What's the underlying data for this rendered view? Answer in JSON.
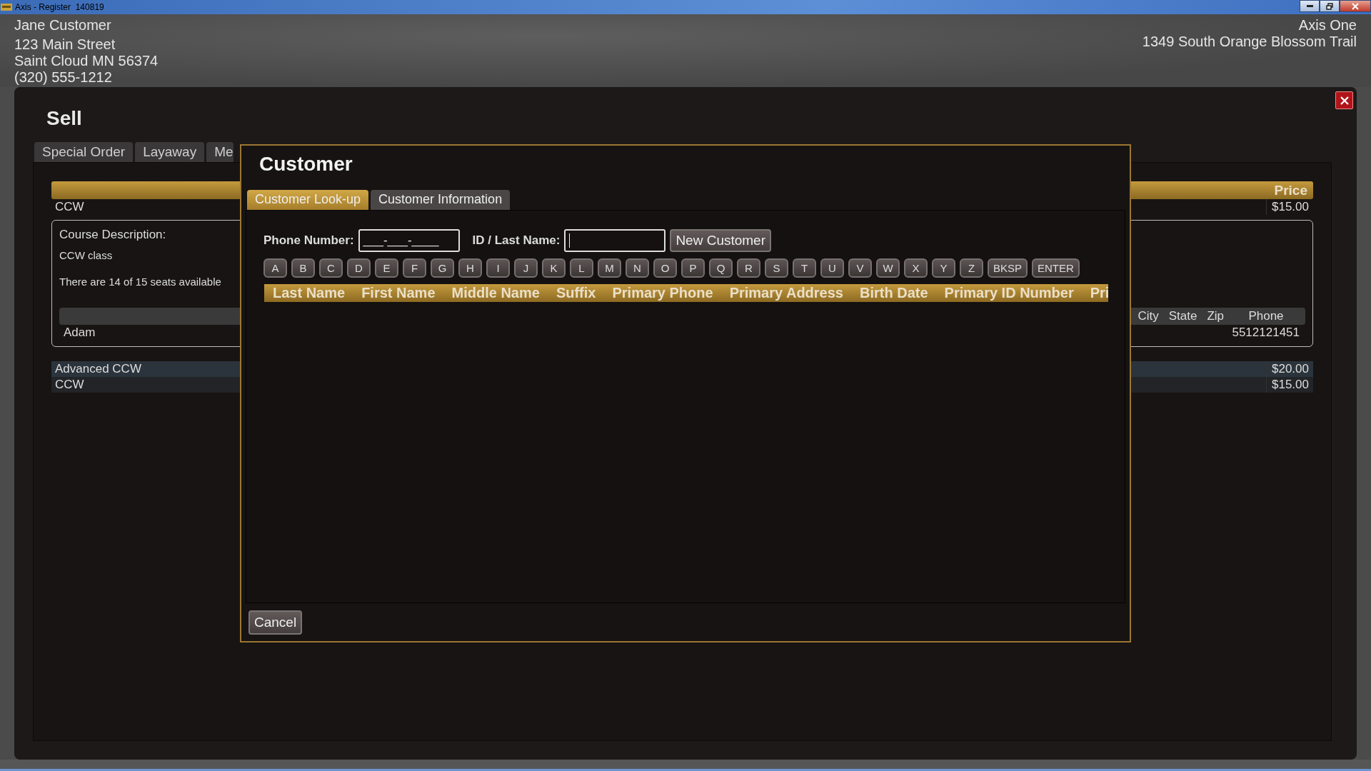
{
  "window": {
    "title": "Axis - Register  140819"
  },
  "customer": {
    "name": "Jane Customer",
    "address_lines": [
      "123 Main Street",
      "Saint Cloud MN 56374",
      "(320) 555-1212"
    ]
  },
  "store": {
    "name": "Axis One",
    "address": "1349 South Orange Blossom Trail"
  },
  "sell": {
    "title": "Sell",
    "sub_tabs": [
      {
        "label": "Special Order",
        "selected": false
      },
      {
        "label": "Layaway",
        "selected": false
      },
      {
        "label": "Me",
        "selected": false
      }
    ],
    "classes_table": {
      "price_header": "Price",
      "rows": [
        {
          "title": "CCW",
          "price": "$15.00",
          "selected": false,
          "expanded": true,
          "detail": {
            "heading": "Course Description:",
            "description": "CCW class",
            "seats": "There are 14 of 15 seats available",
            "attendee_columns": [
              "City",
              "State",
              "Zip",
              "Phone"
            ],
            "attendees": [
              {
                "first_name": "Adam",
                "phone": "5512121451"
              }
            ]
          }
        },
        {
          "title": "Advanced CCW",
          "price": "$20.00",
          "selected": true,
          "expanded": false
        },
        {
          "title": "CCW",
          "price": "$15.00",
          "selected": false,
          "expanded": false
        }
      ]
    }
  },
  "dialog": {
    "title": "Customer",
    "tabs": [
      {
        "label": "Customer Look-up",
        "selected": true
      },
      {
        "label": "Customer Information",
        "selected": false
      }
    ],
    "phone_field": {
      "label": "Phone Number:",
      "value": "___-___-____"
    },
    "id_field": {
      "label": "ID / Last Name:",
      "focused": true
    },
    "new_customer_button": "New Customer",
    "keys": [
      "A",
      "B",
      "C",
      "D",
      "E",
      "F",
      "G",
      "H",
      "I",
      "J",
      "K",
      "L",
      "M",
      "N",
      "O",
      "P",
      "Q",
      "R",
      "S",
      "T",
      "U",
      "V",
      "W",
      "X",
      "Y",
      "Z",
      "BKSP",
      "ENTER"
    ],
    "results_columns": [
      "Last Name",
      "First Name",
      "Middle Name",
      "Suffix",
      "Primary Phone",
      "Primary Address",
      "Birth Date",
      "Primary ID Number",
      "Pri"
    ],
    "cancel_button": "Cancel"
  }
}
